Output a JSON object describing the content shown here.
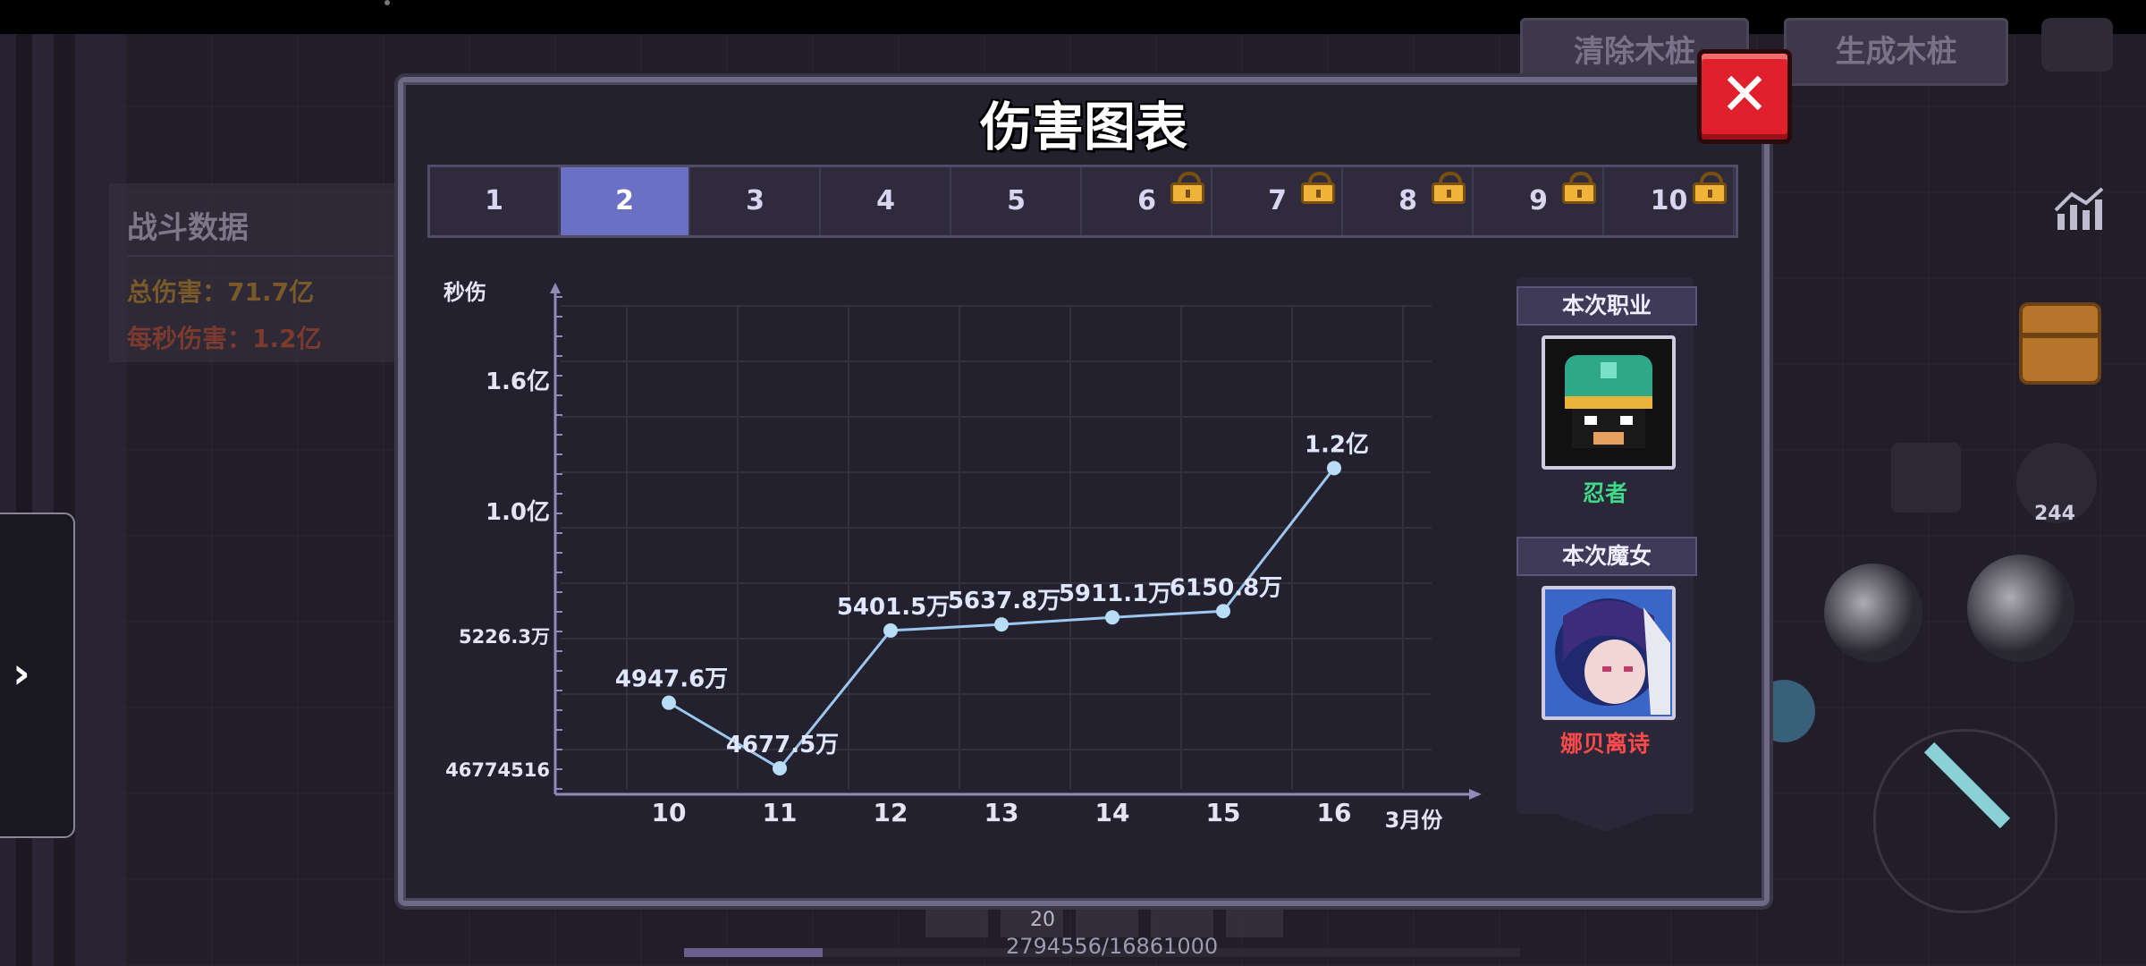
{
  "background": {
    "stats_panel": {
      "title": "战斗数据",
      "total_damage": "总伤害：71.7亿",
      "dps": "每秒伤害：1.2亿"
    },
    "buttons": {
      "clear_stakes": "清除木桩",
      "generate_stakes": "生成木桩"
    },
    "side_toggle_icon": "›",
    "boot_count": "244",
    "hotbar_count": "20",
    "xp_text": "2794556/16861000",
    "xp_fraction": 0.166
  },
  "modal": {
    "title": "伤害图表",
    "close_label": "✕",
    "tabs": [
      {
        "label": "1",
        "locked": false,
        "active": false
      },
      {
        "label": "2",
        "locked": false,
        "active": true
      },
      {
        "label": "3",
        "locked": false,
        "active": false
      },
      {
        "label": "4",
        "locked": false,
        "active": false
      },
      {
        "label": "5",
        "locked": false,
        "active": false
      },
      {
        "label": "6",
        "locked": true,
        "active": false
      },
      {
        "label": "7",
        "locked": true,
        "active": false
      },
      {
        "label": "8",
        "locked": true,
        "active": false
      },
      {
        "label": "9",
        "locked": true,
        "active": false
      },
      {
        "label": "10",
        "locked": true,
        "active": false
      }
    ],
    "side": {
      "class_header": "本次职业",
      "class_name": "忍者",
      "witch_header": "本次魔女",
      "witch_name": "娜贝离诗"
    }
  },
  "chart_data": {
    "type": "line",
    "ylabel": "秒伤",
    "xlabel": "3月份",
    "x": [
      10,
      11,
      12,
      13,
      14,
      15,
      16
    ],
    "values": [
      49476000,
      46775000,
      54015000,
      56378000,
      59111000,
      61508000,
      120000000
    ],
    "data_labels": [
      "4947.6万",
      "4677.5万",
      "5401.5万",
      "5637.8万",
      "5911.1万",
      "6150.8万",
      "1.2亿"
    ],
    "y_ticks": [
      {
        "value": 46774516,
        "label": "46774516"
      },
      {
        "value": 52263000,
        "label": "5226.3万"
      },
      {
        "value": 100000000,
        "label": "1.0亿"
      },
      {
        "value": 160000000,
        "label": "1.6亿"
      }
    ],
    "x_tick_labels": [
      "10",
      "11",
      "12",
      "13",
      "14",
      "15",
      "16"
    ],
    "colors": {
      "line": "#9cc7ee",
      "point": "#b9dcf7",
      "axis": "#8f8bb8",
      "grid": "#34313f"
    }
  }
}
